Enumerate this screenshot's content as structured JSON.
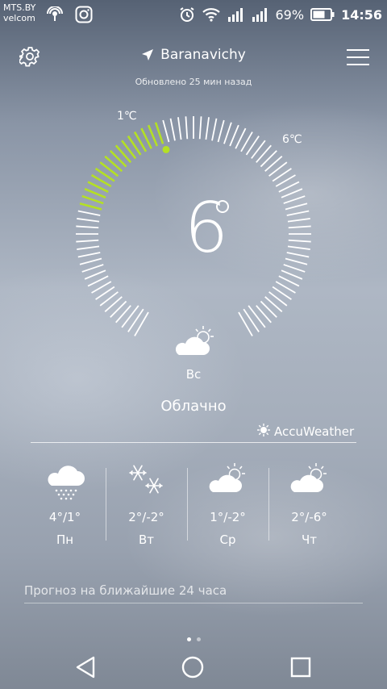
{
  "status_bar": {
    "carrier_1": "MTS.BY",
    "carrier_2": "velcom",
    "battery": "69%",
    "time": "14:56"
  },
  "header": {
    "location": "Baranavichy",
    "updated": "Обновлено 25 мин назад"
  },
  "current": {
    "temperature": "6",
    "min_label": "1℃",
    "max_label": "6℃",
    "day": "Вс",
    "condition": "Облачно",
    "range_fraction_low": 0.24,
    "range_fraction_high": 0.44,
    "accent_color": "#b4e024"
  },
  "provider": "AccuWeather",
  "forecast": [
    {
      "day": "Пн",
      "temp": "4°/1°",
      "icon": "rain-cloud-icon"
    },
    {
      "day": "Вт",
      "temp": "2°/-2°",
      "icon": "snowflakes-icon"
    },
    {
      "day": "Ср",
      "temp": "1°/-2°",
      "icon": "partly-cloudy-icon"
    },
    {
      "day": "Чт",
      "temp": "2°/-6°",
      "icon": "partly-cloudy-icon"
    }
  ],
  "hourly_title": "Прогноз на ближайшие 24 часа"
}
